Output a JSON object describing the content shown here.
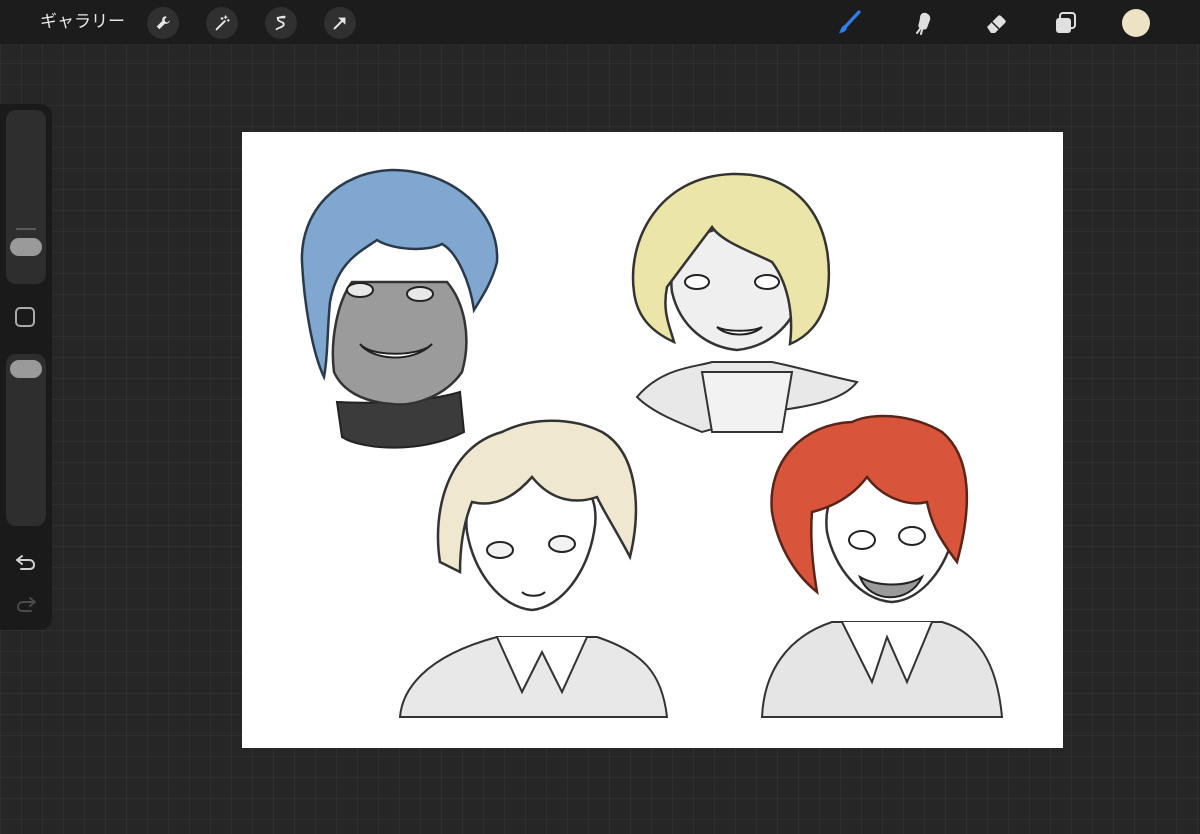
{
  "topbar": {
    "gallery_label": "ギャラリー",
    "left_tools": [
      {
        "icon": "wrench-icon",
        "name": "actions"
      },
      {
        "icon": "magic-wand-icon",
        "name": "adjustments"
      },
      {
        "icon": "selection-icon",
        "name": "selection"
      },
      {
        "icon": "transform-arrow-icon",
        "name": "transform"
      }
    ],
    "right_tools": [
      {
        "icon": "brush-icon",
        "name": "brush",
        "active": true
      },
      {
        "icon": "smudge-icon",
        "name": "smudge"
      },
      {
        "icon": "eraser-icon",
        "name": "eraser"
      },
      {
        "icon": "layers-icon",
        "name": "layers"
      }
    ],
    "current_color": "#ece3c4",
    "active_color": "#2f7ff0"
  },
  "sidebar": {
    "brush_size_level": 0.3,
    "opacity_level": 0.95,
    "buttons": [
      "modify-button",
      "undo-button",
      "redo-button"
    ]
  },
  "canvas": {
    "background": "#ffffff",
    "hair_colors": {
      "blue": "#7fa7cf",
      "blonde": "#ebe6a8",
      "pale": "#efe7cf",
      "red": "#d8553b"
    }
  }
}
